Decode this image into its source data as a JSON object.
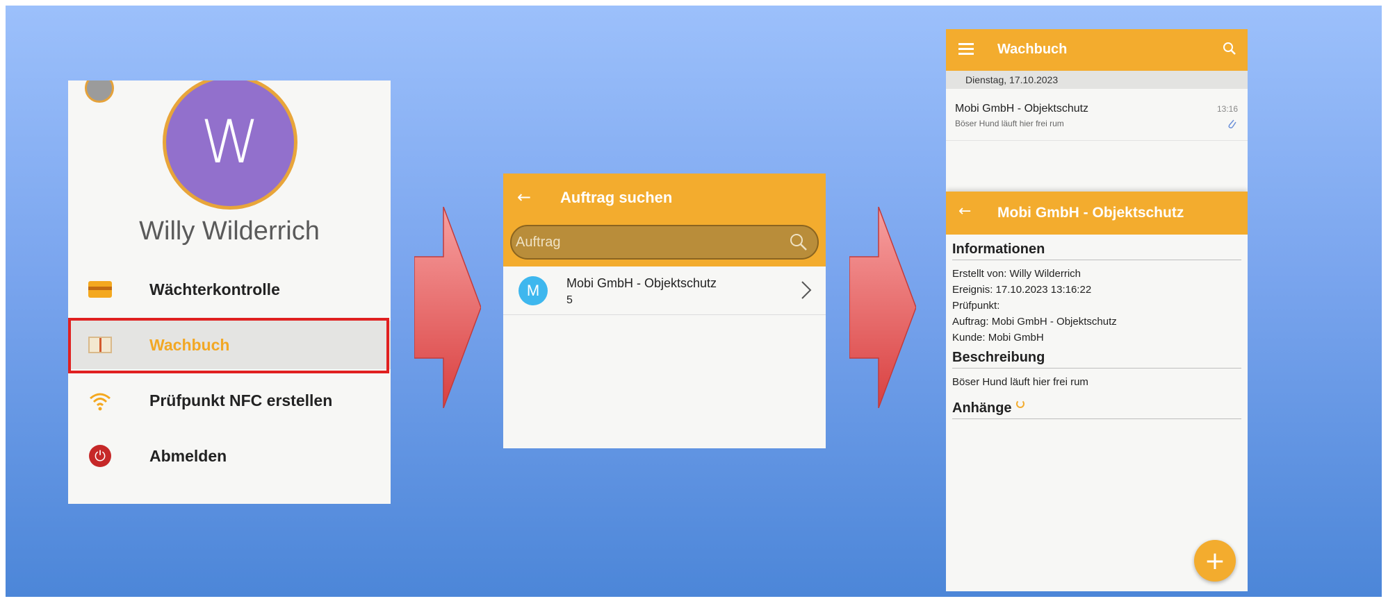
{
  "drawer": {
    "avatar_letter": "W",
    "user_name": "Willy Wilderrich",
    "items": [
      {
        "label": "Wächterkontrolle",
        "icon": "card-icon"
      },
      {
        "label": "Wachbuch",
        "icon": "book-icon",
        "active": true
      },
      {
        "label": "Prüfpunkt NFC erstellen",
        "icon": "nfc-icon"
      },
      {
        "label": "Abmelden",
        "icon": "power-icon"
      }
    ]
  },
  "search": {
    "back_icon": "←",
    "title": "Auftrag suchen",
    "placeholder": "Auftrag",
    "result": {
      "initial": "M",
      "title": "Mobi GmbH - Objektschutz",
      "subtitle": "5"
    }
  },
  "wachbuch": {
    "title": "Wachbuch",
    "date": "Dienstag, 17.10.2023",
    "entry": {
      "title": "Mobi GmbH - Objektschutz",
      "time": "13:16",
      "subtitle": "Böser Hund läuft hier frei rum"
    },
    "detail": {
      "back_icon": "←",
      "title": "Mobi GmbH - Objektschutz",
      "info_heading": "Informationen",
      "info_lines": [
        "Erstellt von: Willy Wilderrich",
        "Ereignis: 17.10.2023 13:16:22",
        "Prüfpunkt:",
        "Auftrag: Mobi GmbH - Objektschutz",
        "Kunde: Mobi GmbH"
      ],
      "desc_heading": "Beschreibung",
      "desc_text": "Böser Hund läuft hier frei rum",
      "attach_heading": "Anhänge"
    },
    "fab_label": "+"
  },
  "colors": {
    "accent": "#f3ac2e",
    "highlight": "#e02020",
    "avatar": "#9270cc",
    "arrow_fill": "#e0585a"
  }
}
